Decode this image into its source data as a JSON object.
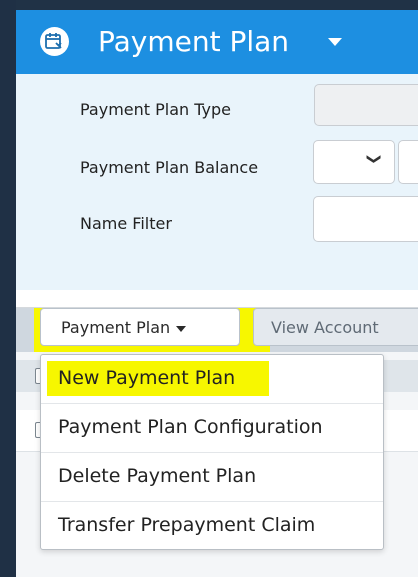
{
  "header": {
    "title": "Payment Plan",
    "icon": "calendar-icon",
    "accent_color": "#1d8fe1"
  },
  "filters": {
    "type_label": "Payment Plan Type",
    "balance_label": "Payment Plan Balance",
    "name_label": "Name Filter",
    "balance_select_arrow": "❯"
  },
  "toolbar": {
    "payment_plan_button": "Payment Plan",
    "view_account_button": "View Account"
  },
  "dropdown_menu": {
    "items": [
      {
        "label": "New Payment Plan",
        "highlighted": true
      },
      {
        "label": "Payment Plan Configuration"
      },
      {
        "label": "Delete Payment Plan"
      },
      {
        "label": "Transfer Prepayment Claim"
      }
    ]
  },
  "highlight_color": "#f7f700"
}
